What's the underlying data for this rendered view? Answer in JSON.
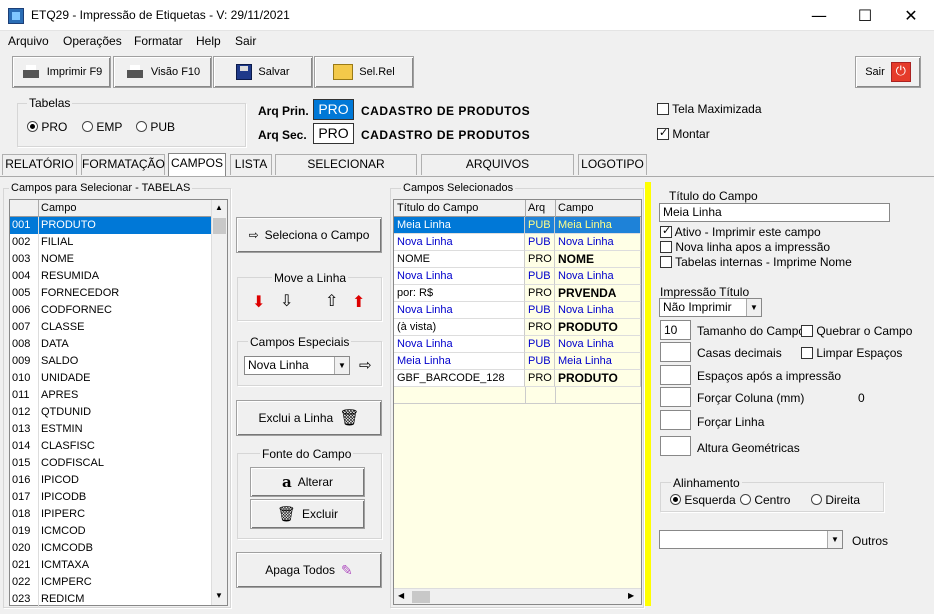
{
  "window": {
    "title": "ETQ29 - Impressão de Etiquetas - V: 29/11/2021",
    "min_glyph": "—",
    "max_glyph": "☐",
    "close_glyph": "✕"
  },
  "menu": [
    "Arquivo",
    "Operações",
    "Formatar",
    "Help",
    "Sair"
  ],
  "toolbar": {
    "print_label": "Imprimir F9",
    "preview_label": "Visão F10",
    "save_label": "Salvar",
    "selrel_label": "Sel.Rel",
    "exit_label": "Sair"
  },
  "tabelas": {
    "label": "Tabelas",
    "options": [
      "PRO",
      "EMP",
      "PUB"
    ],
    "selected": "PRO"
  },
  "arq": {
    "prin_label": "Arq Prin.",
    "prin_code": "PRO",
    "prin_desc": "CADASTRO DE PRODUTOS",
    "sec_label": "Arq Sec.",
    "sec_code": "PRO",
    "sec_desc": "CADASTRO DE PRODUTOS"
  },
  "options_top": {
    "tela_max": "Tela Maximizada",
    "tela_max_checked": false,
    "montar": "Montar",
    "montar_checked": true
  },
  "tabs": [
    "RELATÓRIO",
    "FORMATAÇÃO",
    "CAMPOS",
    "LISTA",
    "SELECIONAR PRODUTOS",
    "ARQUIVOS RELACIONADOS",
    "LOGOTIPO"
  ],
  "active_tab": "CAMPOS",
  "campos_list": {
    "group_label": "Campos para Selecionar  - TABELAS",
    "col_header": "Campo",
    "rows": [
      [
        "001",
        "PRODUTO"
      ],
      [
        "002",
        "FILIAL"
      ],
      [
        "003",
        "NOME"
      ],
      [
        "004",
        "RESUMIDA"
      ],
      [
        "005",
        "FORNECEDOR"
      ],
      [
        "006",
        "CODFORNEC"
      ],
      [
        "007",
        "CLASSE"
      ],
      [
        "008",
        "DATA"
      ],
      [
        "009",
        "SALDO"
      ],
      [
        "010",
        "UNIDADE"
      ],
      [
        "011",
        "APRES"
      ],
      [
        "012",
        "QTDUNID"
      ],
      [
        "013",
        "ESTMIN"
      ],
      [
        "014",
        "CLASFISC"
      ],
      [
        "015",
        "CODFISCAL"
      ],
      [
        "016",
        "IPICOD"
      ],
      [
        "017",
        "IPICODB"
      ],
      [
        "018",
        "IPIPERC"
      ],
      [
        "019",
        "ICMCOD"
      ],
      [
        "020",
        "ICMCODB"
      ],
      [
        "021",
        "ICMTAXA"
      ],
      [
        "022",
        "ICMPERC"
      ],
      [
        "023",
        "REDICM"
      ]
    ]
  },
  "middle": {
    "seleciona": "Seleciona o Campo",
    "move_label": "Move a Linha",
    "especiais_label": "Campos Especiais",
    "especiais_value": "Nova Linha",
    "exclui": "Exclui a Linha",
    "fonte_label": "Fonte do Campo",
    "alterar": "Alterar",
    "excluir": "Excluir",
    "apaga": "Apaga Todos"
  },
  "selecionados": {
    "group_label": "Campos Selecionados",
    "headers": [
      "Título do Campo",
      "Arq",
      "Campo"
    ],
    "rows": [
      {
        "titulo": "Meia Linha",
        "arq": "PUB",
        "campo": "Meia Linha",
        "kind": "pub",
        "selected": true
      },
      {
        "titulo": "Nova Linha",
        "arq": "PUB",
        "campo": "Nova Linha",
        "kind": "pub"
      },
      {
        "titulo": "NOME",
        "arq": "PRO",
        "campo": "NOME",
        "kind": "pro"
      },
      {
        "titulo": "Nova Linha",
        "arq": "PUB",
        "campo": "Nova Linha",
        "kind": "pub"
      },
      {
        "titulo": "  por: R$",
        "arq": "PRO",
        "campo": "PRVENDA",
        "kind": "pro"
      },
      {
        "titulo": "Nova Linha",
        "arq": "PUB",
        "campo": "Nova Linha",
        "kind": "pub"
      },
      {
        "titulo": "(à vista)",
        "arq": "PRO",
        "campo": "PRODUTO",
        "kind": "pro"
      },
      {
        "titulo": "Nova Linha",
        "arq": "PUB",
        "campo": "Nova Linha",
        "kind": "pub"
      },
      {
        "titulo": "Meia Linha",
        "arq": "PUB",
        "campo": "Meia Linha",
        "kind": "pub"
      },
      {
        "titulo": "GBF_BARCODE_128",
        "arq": "PRO",
        "campo": "PRODUTO",
        "kind": "pro"
      }
    ]
  },
  "props": {
    "titulo_label": "Título do Campo",
    "titulo_value": "Meia Linha",
    "ativo": "Ativo - Imprimir este campo",
    "ativo_checked": true,
    "nova_linha": "Nova linha apos a impressão",
    "nova_linha_checked": false,
    "tabelas_int": "Tabelas internas - Imprime Nome",
    "tabelas_int_checked": false,
    "impressao_label": "Impressão Título",
    "impressao_value": "Não Imprimir",
    "tamanho_value": "10",
    "tamanho_label": "Tamanho do Campo",
    "quebrar": "Quebrar o Campo",
    "casas": "Casas decimais",
    "limpar": "Limpar Espaços",
    "espacos": "Espaços após a impressão",
    "forcar_col": "Forçar Coluna (mm)",
    "forcar_col_value": "0",
    "forcar_linha": "Forçar Linha",
    "altura": "Altura Geométricas",
    "alinhamento_label": "Alinhamento",
    "alinhamento_opts": [
      "Esquerda",
      "Centro",
      "Direita"
    ],
    "alinhamento_selected": "Esquerda",
    "outros": "Outros"
  },
  "colors": {
    "selection": "#0078d7",
    "pub_text": "#0000cc",
    "grid_bg": "#ffffe6",
    "yellow_bar": "#ffff00",
    "arq_bg": "#0078d7"
  }
}
